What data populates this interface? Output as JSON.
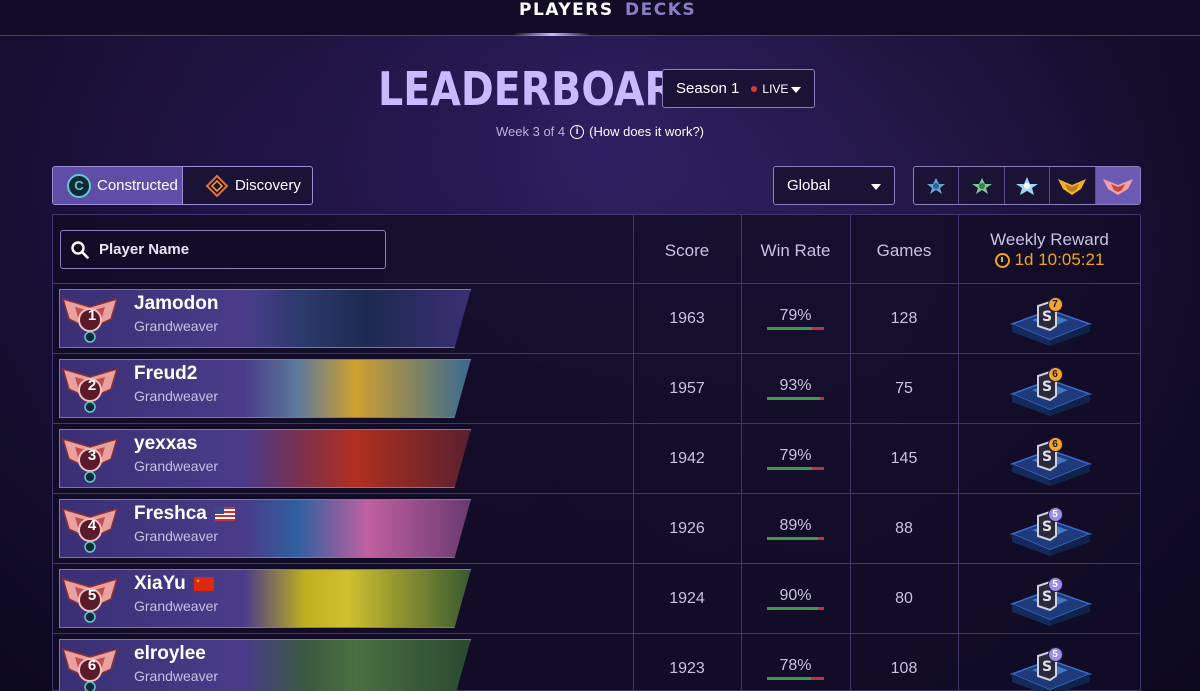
{
  "nav": {
    "tabs": [
      {
        "label": "PLAYERS"
      },
      {
        "label": "DECKS"
      }
    ]
  },
  "header": {
    "title": "LEADERBOARD",
    "season_label": "Season 1",
    "live_label": "LIVE",
    "week_text": "Week 3 of 4",
    "how_link": "(How does it work?)"
  },
  "modes": [
    {
      "label": "Constructed"
    },
    {
      "label": "Discovery"
    }
  ],
  "region": {
    "selected": "Global"
  },
  "table": {
    "search_placeholder": "Player Name",
    "columns": {
      "score": "Score",
      "win_rate": "Win Rate",
      "games": "Games",
      "reward": "Weekly Reward"
    },
    "reward_timer": "1d 10:05:21",
    "rows": [
      {
        "rank": "1",
        "name": "Jamodon",
        "title": "Grandweaver",
        "flag": "",
        "score": "1963",
        "win_rate": "79%",
        "win_rate_value": 0.79,
        "games": "128",
        "reward": "7"
      },
      {
        "rank": "2",
        "name": "Freud2",
        "title": "Grandweaver",
        "flag": "",
        "score": "1957",
        "win_rate": "93%",
        "win_rate_value": 0.93,
        "games": "75",
        "reward": "6"
      },
      {
        "rank": "3",
        "name": "yexxas",
        "title": "Grandweaver",
        "flag": "",
        "score": "1942",
        "win_rate": "79%",
        "win_rate_value": 0.79,
        "games": "145",
        "reward": "6"
      },
      {
        "rank": "4",
        "name": "Freshca",
        "title": "Grandweaver",
        "flag": "us",
        "score": "1926",
        "win_rate": "89%",
        "win_rate_value": 0.89,
        "games": "88",
        "reward": "5"
      },
      {
        "rank": "5",
        "name": "XiaYu",
        "title": "Grandweaver",
        "flag": "cn",
        "score": "1924",
        "win_rate": "90%",
        "win_rate_value": 0.9,
        "games": "80",
        "reward": "5"
      },
      {
        "rank": "6",
        "name": "elroylee",
        "title": "Grandweaver",
        "flag": "",
        "score": "1923",
        "win_rate": "78%",
        "win_rate_value": 0.78,
        "games": "108",
        "reward": "5"
      }
    ]
  }
}
